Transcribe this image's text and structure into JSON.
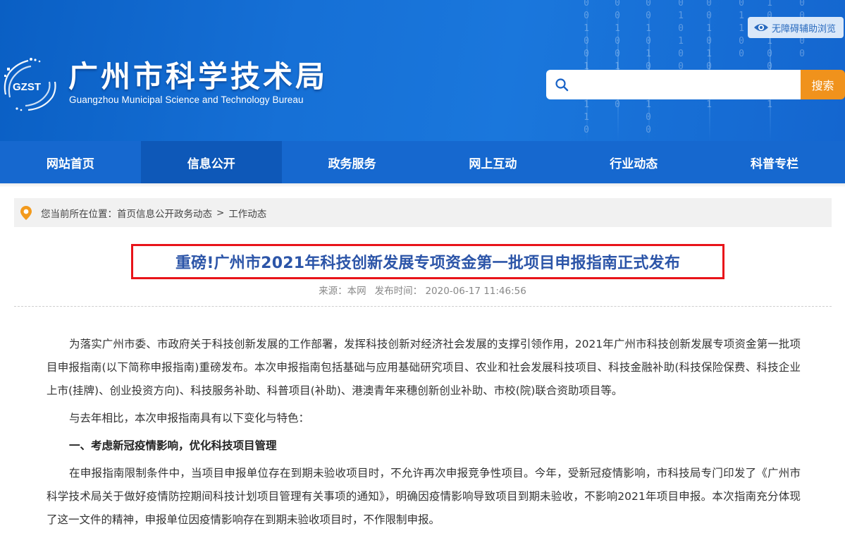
{
  "header": {
    "org_name": "广州市科学技术局",
    "org_name_en": "Guangzhou Municipal Science and Technology Bureau",
    "logo_text": "GZST",
    "accessibility_label": "无障碍辅助浏览",
    "search": {
      "placeholder": "",
      "button_label": "搜索"
    }
  },
  "nav": {
    "items": [
      {
        "label": "网站首页"
      },
      {
        "label": "信息公开"
      },
      {
        "label": "政务服务"
      },
      {
        "label": "网上互动"
      },
      {
        "label": "行业动态"
      },
      {
        "label": "科普专栏"
      }
    ],
    "active_index": 1
  },
  "breadcrumb": {
    "prefix": "您当前所在位置：",
    "path": "首页信息公开政务动态",
    "separator": ">",
    "current": "工作动态"
  },
  "article": {
    "title": "重磅!广州市2021年科技创新发展专项资金第一批项目申报指南正式发布",
    "source_label": "来源：",
    "source": "本网",
    "time_label": "发布时间：",
    "time": "2020-06-17 11:46:56",
    "paragraphs": [
      "为落实广州市委、市政府关于科技创新发展的工作部署，发挥科技创新对经济社会发展的支撑引领作用，2021年广州市科技创新发展专项资金第一批项目申报指南(以下简称申报指南)重磅发布。本次申报指南包括基础与应用基础研究项目、农业和社会发展科技项目、科技金融补助(科技保险保费、科技企业上市(挂牌)、创业投资方向)、科技服务补助、科普项目(补助)、港澳青年来穗创新创业补助、市校(院)联合资助项目等。",
      "与去年相比，本次申报指南具有以下变化与特色：",
      "一、考虑新冠疫情影响，优化科技项目管理",
      "在申报指南限制条件中，当项目申报单位存在到期未验收项目时，不允许再次申报竞争性项目。今年，受新冠疫情影响，市科技局专门印发了《广州市科学技术局关于做好疫情防控期间科技计划项目管理有关事项的通知》，明确因疫情影响导致项目到期未验收，不影响2021年项目申报。本次指南充分体现了这一文件的精神，申报单位因疫情影响存在到期未验收项目时，不作限制申报。"
    ]
  },
  "colors": {
    "header_blue": "#1670d6",
    "nav_blue": "#1668cf",
    "nav_active": "#0e58b8",
    "search_orange": "#f0921c",
    "title_blue": "#2c55a8",
    "highlight_red": "#e8141a",
    "pin_orange": "#f39a1c"
  }
}
